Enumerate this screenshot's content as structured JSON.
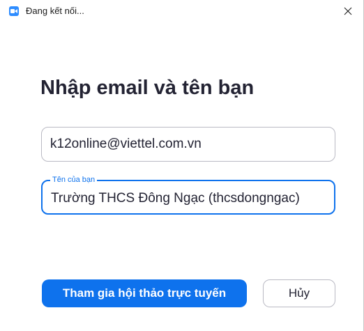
{
  "window": {
    "title": "Đang kết nối..."
  },
  "form": {
    "heading": "Nhập email và tên bạn",
    "email": {
      "value": "k12online@viettel.com.vn"
    },
    "name": {
      "label": "Tên của bạn",
      "value": "Trường THCS Đông Ngạc (thcsdongngac)"
    }
  },
  "actions": {
    "join_label": "Tham gia hội thảo trực tuyến",
    "cancel_label": "Hủy"
  },
  "colors": {
    "accent": "#0e72ed",
    "app_icon": "#2d8cff",
    "text": "#232333",
    "border": "#b9b9c3"
  },
  "icons": {
    "app": "zoom-camera-icon",
    "close": "close-icon"
  }
}
